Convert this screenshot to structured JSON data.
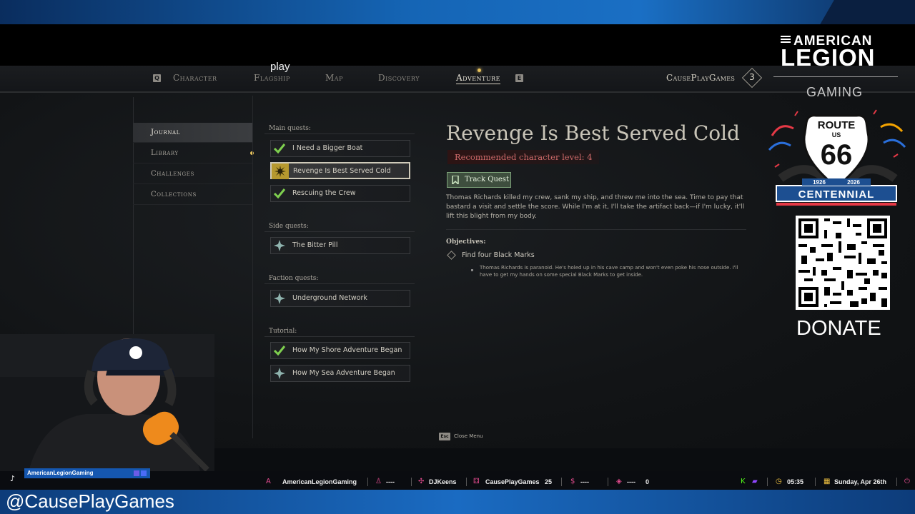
{
  "overlay": {
    "play_text": "play",
    "handle": "@CausePlayGames",
    "brand": {
      "american": "AMERICAN",
      "legion": "LEGION",
      "gaming": "GAMING"
    },
    "route66": {
      "route": "ROUTE",
      "us": "US",
      "number": "66",
      "year_start": "1926",
      "year_end": "2026",
      "centennial": "CENTENNIAL"
    },
    "donate": "DONATE",
    "tiktok_name": "AmericanLegionGaming",
    "stats": {
      "channel": "AmericanLegionGaming",
      "follower": "----",
      "latest": "DJKeens",
      "gift": "CausePlayGames",
      "gift_count": "25",
      "money": "----",
      "bits": "----",
      "bits_count": "0",
      "time": "05:35",
      "date": "Sunday, Apr 26th"
    },
    "colors": {
      "stream_blue": "#1a6fc4",
      "accent_gold": "#e6c15a",
      "rec_red": "#d06b6b",
      "track_green": "#7ea37a"
    }
  },
  "game": {
    "nav": {
      "left_key": "Q",
      "right_key": "E",
      "tabs": [
        "Character",
        "Flagship",
        "Map",
        "Discovery",
        "Adventure"
      ],
      "active_tab": "Adventure",
      "player_name": "CausePlayGames",
      "player_level": "3"
    },
    "menu": {
      "items": [
        "Journal",
        "Library",
        "Challenges",
        "Collections"
      ],
      "active": "Journal"
    },
    "quests": {
      "main_label": "Main quests:",
      "main": [
        "I Need a Bigger Boat",
        "Revenge Is Best Served Cold",
        "Rescuing the Crew"
      ],
      "side_label": "Side quests:",
      "side": [
        "The Bitter Pill"
      ],
      "faction_label": "Faction quests:",
      "faction": [
        "Underground Network"
      ],
      "tutorial_label": "Tutorial:",
      "tutorial": [
        "How My Shore Adventure Began",
        "How My Sea Adventure Began"
      ]
    },
    "detail": {
      "title": "Revenge Is Best Served Cold",
      "recommended": "Recommended character level: 4",
      "track_button": "Track Quest",
      "description": "Thomas Richards killed my crew, sank my ship, and threw me into the sea. Time to pay that bastard a visit and settle the score. While I'm at it, I'll take the artifact back—if I'm lucky, it'll lift this blight from my body.",
      "objectives_label": "Objectives:",
      "objective": "Find four Black Marks",
      "objective_detail": "Thomas Richards is paranoid. He's holed up in his cave camp and won't even poke his nose outside. I'll have to get my hands on some special Black Marks to get inside."
    },
    "close": {
      "key": "Esc",
      "label": "Close Menu"
    }
  }
}
